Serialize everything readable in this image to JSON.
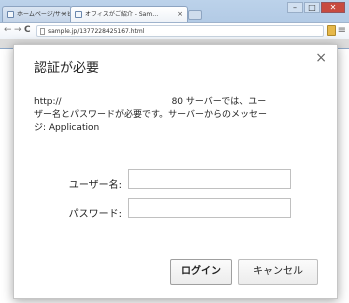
{
  "browser": {
    "tabs": [
      {
        "label": "ホームページ/サービス…",
        "active": false
      },
      {
        "label": "オフィスがご紹介 - Sam…",
        "active": true
      }
    ],
    "window_controls": {
      "minimize": "–",
      "maximize": "□",
      "close": "✕"
    },
    "nav": {
      "back": "←",
      "forward": "→",
      "reload": "C"
    },
    "address": "sample.jp/1377228425167.html",
    "menu_glyph": "≡"
  },
  "dialog": {
    "title": "認証が必要",
    "close_glyph": "×",
    "message_line1_prefix": "http://",
    "message_line1_suffix": "80 サーバーでは、ユー",
    "message_line2": "ザー名とパスワードが必要です。サーバーからのメッセー",
    "message_line3": "ジ: Application",
    "username_label": "ユーザー名:",
    "password_label": "パスワード:",
    "username_value": "",
    "password_value": "",
    "login_button": "ログイン",
    "cancel_button": "キャンセル"
  },
  "colors": {
    "chrome_blue": "#bcd2ea",
    "dialog_bg": "#ffffff",
    "close_button": "#c84a3f"
  }
}
